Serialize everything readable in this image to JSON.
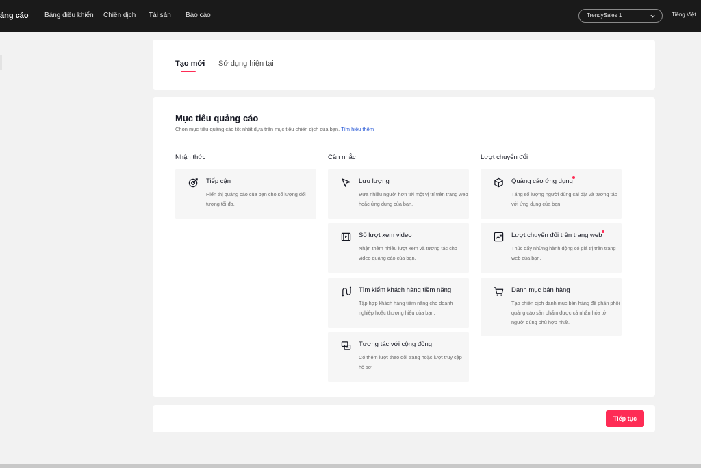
{
  "topbar": {
    "brand": "ảng cáo",
    "nav": [
      "Bảng điều khiển",
      "Chiến dịch",
      "Tài sản",
      "Báo cáo"
    ],
    "account": "TrendySales 1",
    "language": "Tiếng Việt"
  },
  "tabs": {
    "create_new": "Tạo mới",
    "use_existing": "Sử dụng hiện tại"
  },
  "goal": {
    "title": "Mục tiêu quảng cáo",
    "description": "Chọn mục tiêu quảng cáo tốt nhất dựa trên mục tiêu chiến dịch của bạn.",
    "learn_more": "Tìm hiểu thêm"
  },
  "columns": [
    {
      "heading": "Nhận thức",
      "items": [
        {
          "title": "Tiếp cận",
          "desc": "Hiển thị quảng cáo của bạn cho số lượng đối tượng tối đa.",
          "icon": "target-icon",
          "required": false
        }
      ]
    },
    {
      "heading": "Cân nhắc",
      "items": [
        {
          "title": "Lưu lượng",
          "desc": "Đưa nhiều người hơn tới một vị trí trên trang web hoặc ứng dụng của bạn.",
          "icon": "cursor-icon",
          "required": false
        },
        {
          "title": "Số lượt xem video",
          "desc": "Nhận thêm nhiều lượt xem và tương tác cho video quảng cáo của bạn.",
          "icon": "video-icon",
          "required": false
        },
        {
          "title": "Tìm kiếm khách hàng tiềm năng",
          "desc": "Tập hợp khách hàng tiềm năng cho doanh nghiệp hoặc thương hiệu của bạn.",
          "icon": "lead-icon",
          "required": false
        },
        {
          "title": "Tương tác với cộng đồng",
          "desc": "Có thêm lượt theo dõi trang hoặc lượt truy cập hồ sơ.",
          "icon": "community-icon",
          "required": false
        }
      ]
    },
    {
      "heading": "Lượt chuyển đổi",
      "items": [
        {
          "title": "Quảng cáo ứng dụng",
          "desc": "Tăng số lượng người dùng cài đặt và tương tác với ứng dụng của bạn.",
          "icon": "app-cube-icon",
          "required": true
        },
        {
          "title": "Lượt chuyển đổi trên trang web",
          "desc": "Thúc đẩy những hành động có giá trị trên trang web của bạn.",
          "icon": "trend-chart-icon",
          "required": true
        },
        {
          "title": "Danh mục bán hàng",
          "desc": "Tạo chiến dịch danh mục bán hàng để phân phối quảng cáo sản phẩm được cá nhân hóa tới người dùng phù hợp nhất.",
          "icon": "cart-icon",
          "required": false
        }
      ]
    }
  ],
  "footer": {
    "continue": "Tiếp tục"
  },
  "colors": {
    "accent": "#fe2c55",
    "topbar": "#1a1a1a",
    "link": "#2b5bd7"
  }
}
